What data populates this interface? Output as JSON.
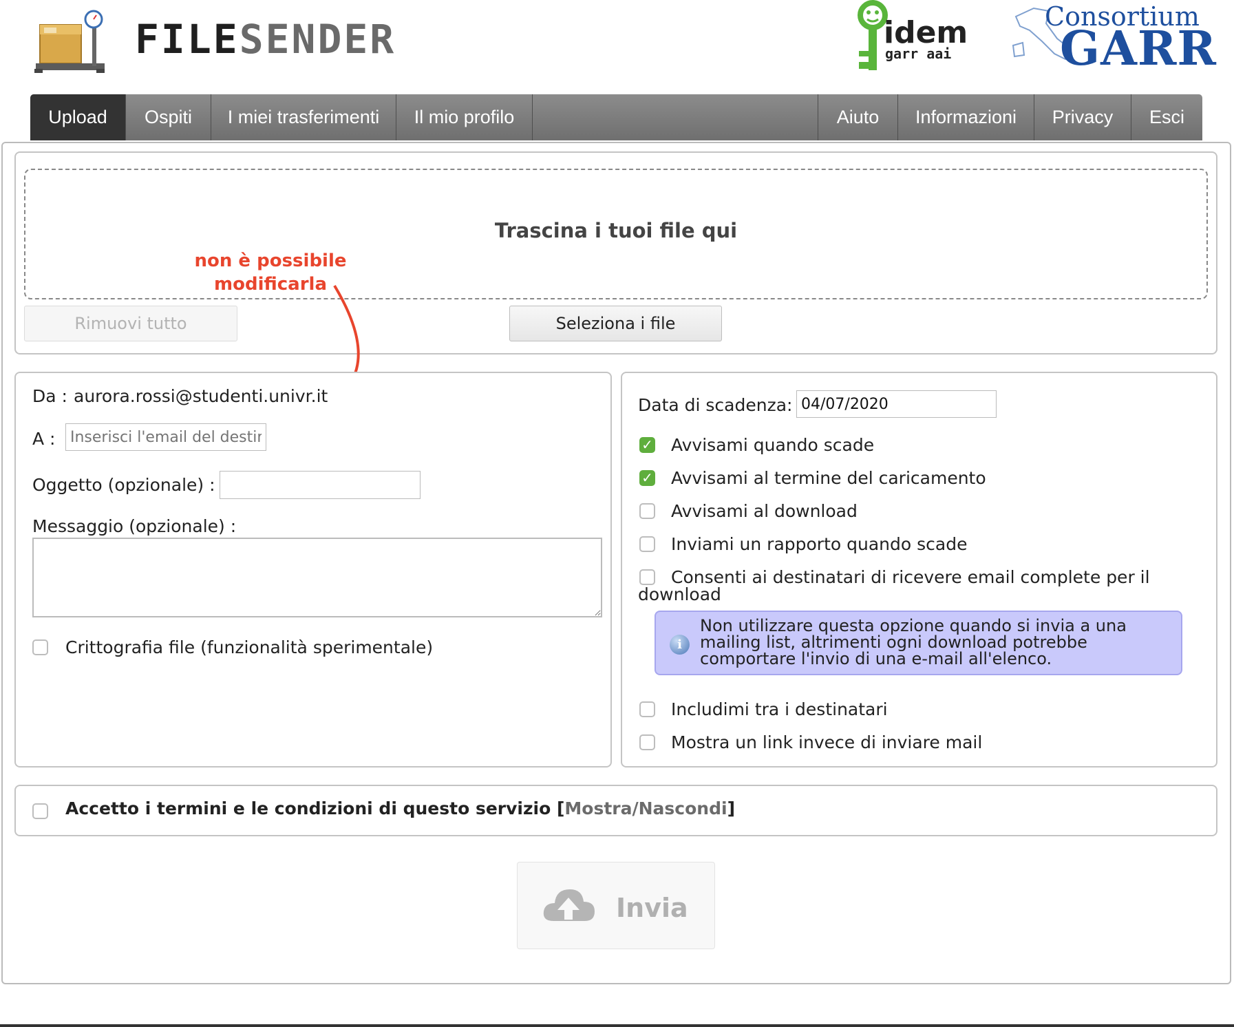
{
  "header": {
    "brand_part1": "FILE",
    "brand_part2": "SENDER",
    "idem_logo_text": "idem",
    "idem_sub_text": "garr aai",
    "garr_top": "Consortium",
    "garr_big": "GARR"
  },
  "nav": {
    "left": [
      "Upload",
      "Ospiti",
      "I miei trasferimenti",
      "Il mio profilo"
    ],
    "right": [
      "Aiuto",
      "Informazioni",
      "Privacy",
      "Esci"
    ],
    "active": "Upload"
  },
  "dropzone": {
    "text": "Trascina i tuoi file qui",
    "remove_all": "Rimuovi tutto",
    "select_files": "Seleziona i file"
  },
  "annotation": {
    "line1": "non è possibile",
    "line2": "modificarla",
    "color": "#e8452d"
  },
  "form": {
    "from_label": "Da :",
    "from_value": "aurora.rossi@studenti.univr.it",
    "to_label": "A :",
    "to_placeholder": "Inserisci l'email del destinatario",
    "subject_label": "Oggetto (opzionale) :",
    "subject_value": "",
    "message_label": "Messaggio (opzionale) :",
    "message_value": "",
    "encryption_label": "Crittografia file (funzionalità sperimentale)"
  },
  "options": {
    "expiry_label": "Data di scadenza:",
    "expiry_value": "04/07/2020",
    "notify_expiry": "Avvisami quando scade",
    "notify_upload_complete": "Avvisami al termine del caricamento",
    "notify_download": "Avvisami al download",
    "report_expiry": "Inviami un rapporto quando scade",
    "full_email_line1": "Consenti ai destinatari di ricevere email complete per il",
    "full_email_line2": "download",
    "info_line1": "Non utilizzare questa opzione quando si invia a una",
    "info_line2": "mailing list, altrimenti ogni download potrebbe",
    "info_line3": "comportare l'invio di una e-mail all'elenco.",
    "include_me": "Includimi tra i destinatari",
    "show_link": "Mostra un link invece di inviare mail",
    "checked": {
      "notify_expiry": true,
      "notify_upload_complete": true,
      "notify_download": false,
      "report_expiry": false,
      "full_email": false,
      "include_me": false,
      "show_link": false
    }
  },
  "terms": {
    "text": "Accetto i termini e le condizioni di questo servizio [",
    "toggle": "Mostra/Nascondi",
    "close": "]"
  },
  "send": {
    "label": "Invia",
    "icon": "cloud-upload-icon"
  },
  "colors": {
    "nav_bg": "#7f7f7f",
    "nav_active": "#333333",
    "check_on": "#5fae3d",
    "info_bg": "#c9c9fb",
    "garr_blue": "#1e4f9e"
  }
}
